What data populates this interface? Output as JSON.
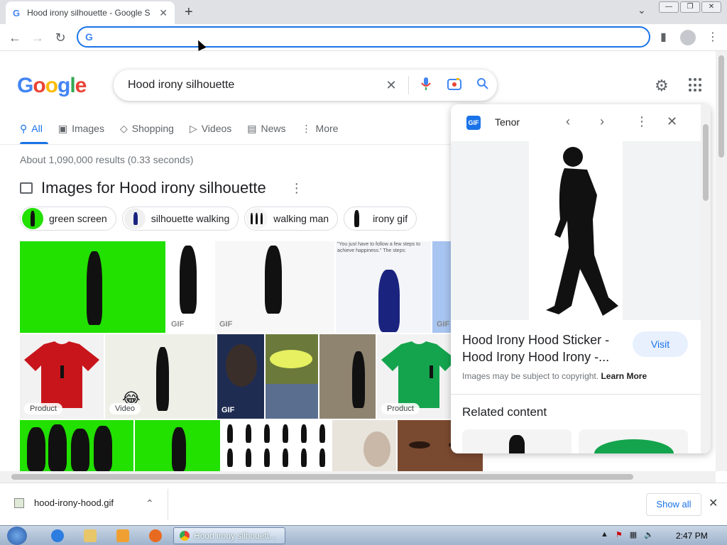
{
  "browser": {
    "tab_title": "Hood irony silhouette - Google S",
    "tab_favicon": "G",
    "new_tab": "+",
    "url": ""
  },
  "google": {
    "logo": [
      "G",
      "o",
      "o",
      "g",
      "l",
      "e"
    ],
    "query": "Hood irony silhouette"
  },
  "nav_tabs": [
    {
      "label": "All",
      "icon": "search-icon"
    },
    {
      "label": "Images",
      "icon": "image-icon"
    },
    {
      "label": "Shopping",
      "icon": "tag-icon"
    },
    {
      "label": "Videos",
      "icon": "play-icon"
    },
    {
      "label": "News",
      "icon": "news-icon"
    },
    {
      "label": "More",
      "icon": "more-vert-icon"
    }
  ],
  "results": {
    "stats": "About 1,090,000 results (0.33 seconds)",
    "images_heading": "Images for Hood irony silhouette"
  },
  "chips": [
    {
      "label": "green screen"
    },
    {
      "label": "silhouette walking"
    },
    {
      "label": "walking man"
    },
    {
      "label": "irony gif"
    }
  ],
  "grid": {
    "badges": {
      "gif": "GIF",
      "product": "Product",
      "video": "Video"
    },
    "quote_text": "\"You just have to follow a few steps to achieve happiness.\" The steps:"
  },
  "panel": {
    "source": "Tenor",
    "source_logo": "GIF",
    "title": "Hood Irony Hood Sticker - Hood Irony Hood Irony -...",
    "visit_label": "Visit",
    "copyright_text": "Images may be subject to copyright.",
    "learn_more": "Learn More",
    "related_heading": "Related content"
  },
  "download": {
    "filename": "hood-irony-hood.gif",
    "show_all": "Show all"
  },
  "taskbar": {
    "active_task": "Hood irony silhouett...",
    "clock": "2:47 PM"
  },
  "colors": {
    "accent": "#1a73e8",
    "green_screen": "#22e000",
    "red_shirt": "#c8151b",
    "green_shirt": "#14a44d"
  }
}
